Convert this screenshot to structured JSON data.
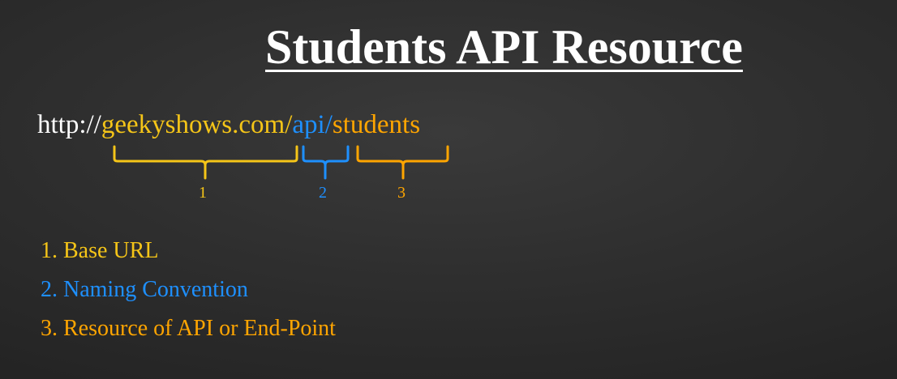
{
  "title": "Students API Resource",
  "colors": {
    "base_url": "#f5c518",
    "naming": "#1e90ff",
    "resource": "#ffa500",
    "protocol": "#ffffff"
  },
  "url": {
    "protocol": "http://",
    "base": "geekyshows.com/",
    "naming": "api/",
    "resource": "students"
  },
  "brace_labels": [
    "1",
    "2",
    "3"
  ],
  "legend": [
    {
      "text": "1. Base URL"
    },
    {
      "text": "2. Naming Convention"
    },
    {
      "text": "3. Resource of API or End-Point"
    }
  ]
}
